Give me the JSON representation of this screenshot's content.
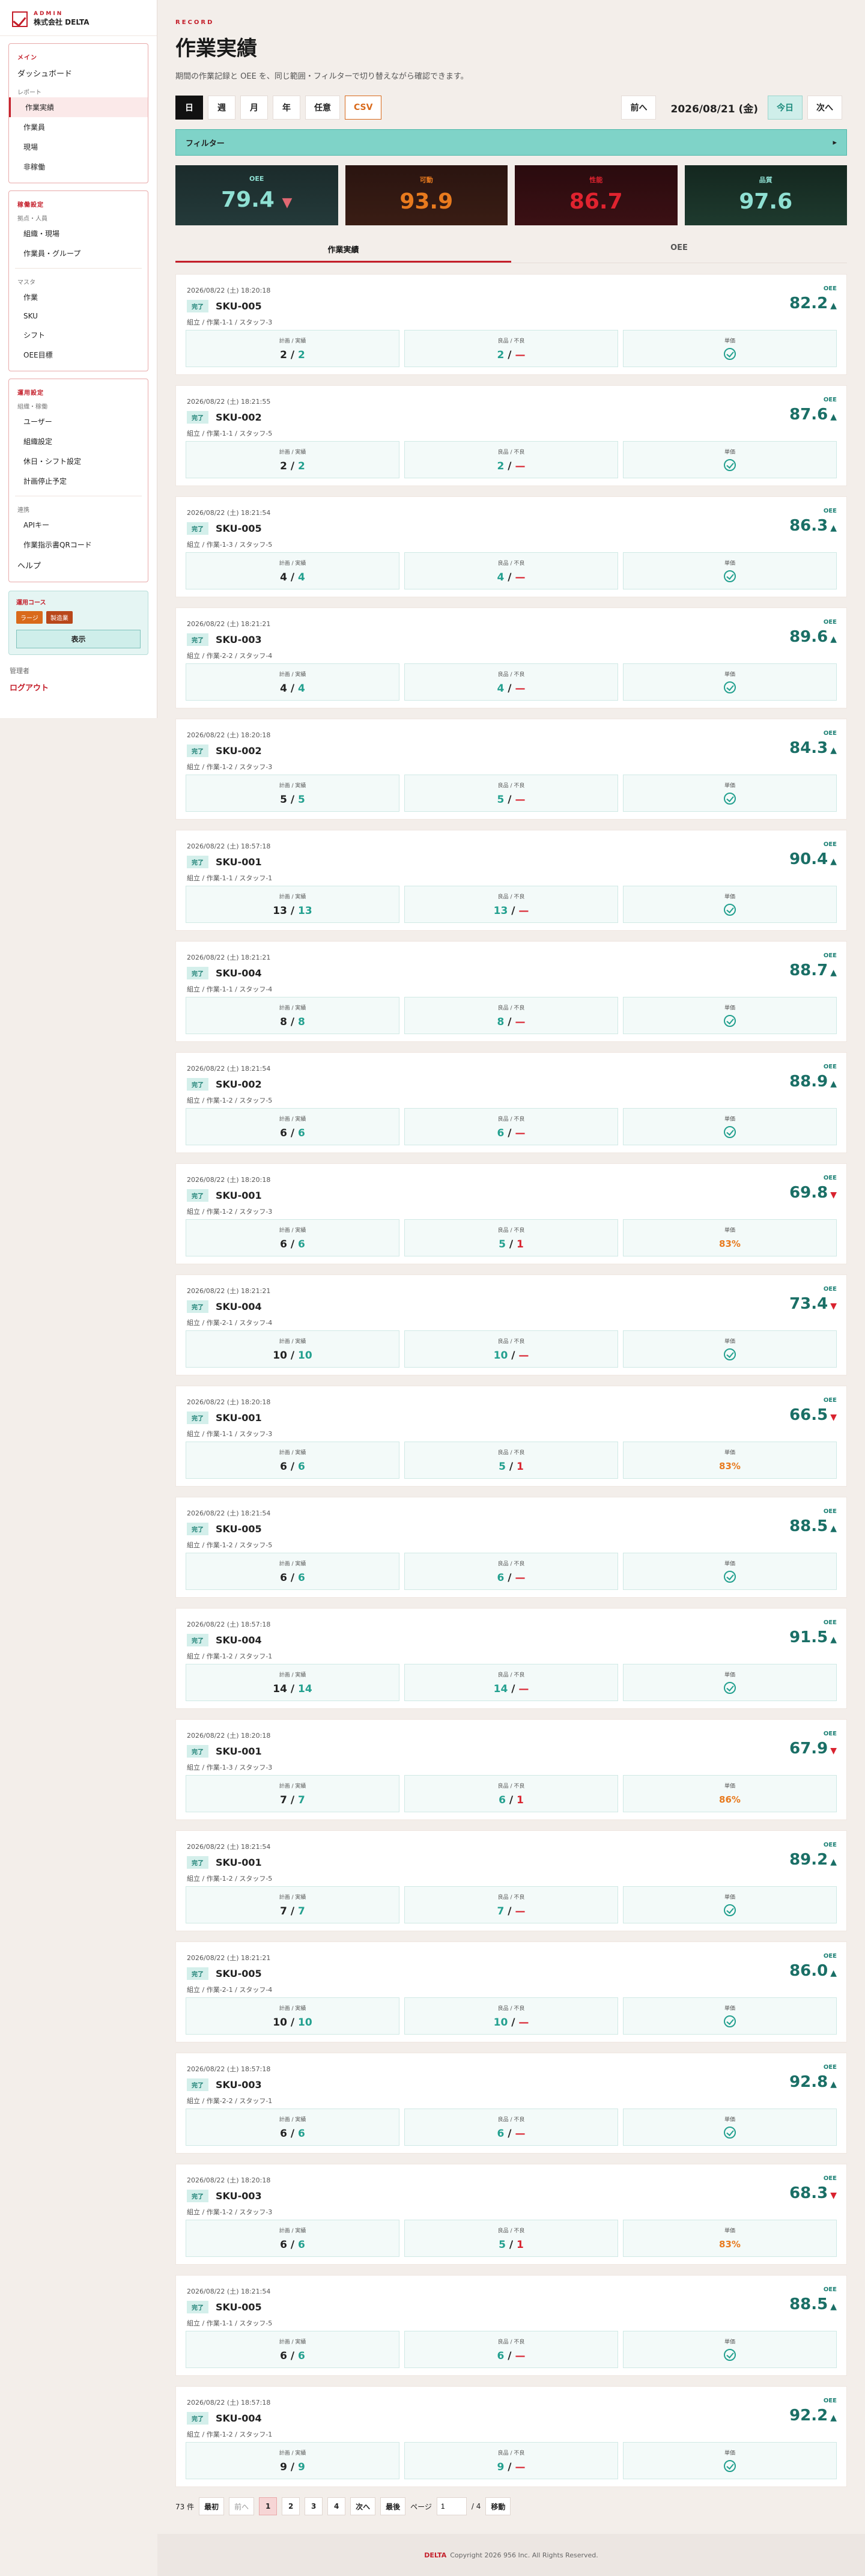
{
  "brand": {
    "small": "ADMIN",
    "name": "株式会社 DELTA"
  },
  "nav": {
    "main_head": "メイン",
    "dashboard": "ダッシュボード",
    "report_sub": "レポート",
    "report_items": [
      "作業実績",
      "作業員",
      "現場",
      "非稼働"
    ],
    "base_head": "稼働設定",
    "base_sub": "拠点・人員",
    "base_items": [
      "組織・現場",
      "作業員・グループ"
    ],
    "master_sub": "マスタ",
    "master_items": [
      "作業",
      "SKU",
      "シフト",
      "OEE目標"
    ],
    "ops_head": "運用設定",
    "ops_sub": "組織・稼働",
    "ops_items": [
      "ユーザー",
      "組織設定",
      "休日・シフト設定",
      "計画停止予定"
    ],
    "link_sub": "連携",
    "link_items": [
      "APIキー",
      "作業指示書QRコード"
    ],
    "help": "ヘルプ"
  },
  "legend": {
    "title": "運用コース",
    "chips": [
      "ラージ",
      "製造業"
    ],
    "button": "表示"
  },
  "user": {
    "role": "管理者",
    "logout": "ログアウト"
  },
  "page": {
    "tag": "RECORD",
    "title": "作業実績",
    "desc": "期間の作業記録と OEE を、同じ範囲・フィルターで切り替えながら確認できます。"
  },
  "toolbar": {
    "periods": [
      "日",
      "週",
      "月",
      "年",
      "任意"
    ],
    "csv": "CSV",
    "prev": "前へ",
    "date": "2026/08/21 (金)",
    "today": "今日",
    "next": "次へ"
  },
  "filter": {
    "label": "フィルター",
    "icon": "▸"
  },
  "kpis": [
    {
      "label": "OEE",
      "value": "79.4"
    },
    {
      "label": "可動",
      "value": "93.9"
    },
    {
      "label": "性能",
      "value": "86.7"
    },
    {
      "label": "品質",
      "value": "97.6"
    }
  ],
  "tabs": [
    "作業実績",
    "OEE"
  ],
  "labels": {
    "oee": "OEE",
    "plan": "計画 / 実績",
    "good": "良品 / 不良",
    "perf": "単価",
    "status": "完了",
    "dash": "—"
  },
  "records": [
    {
      "time": "2026/08/22 (土) 18:20:18",
      "sku": "SKU-005",
      "path": "組立 / 作業-1-1 / スタッフ-3",
      "oee": "82.2",
      "up": true,
      "plan": "2",
      "actual": "2",
      "good": "2",
      "bad": "—",
      "perf": ""
    },
    {
      "time": "2026/08/22 (土) 18:21:55",
      "sku": "SKU-002",
      "path": "組立 / 作業-1-1 / スタッフ-5",
      "oee": "87.6",
      "up": true,
      "plan": "2",
      "actual": "2",
      "good": "2",
      "bad": "—",
      "perf": ""
    },
    {
      "time": "2026/08/22 (土) 18:21:54",
      "sku": "SKU-005",
      "path": "組立 / 作業-1-3 / スタッフ-5",
      "oee": "86.3",
      "up": true,
      "plan": "4",
      "actual": "4",
      "good": "4",
      "bad": "—",
      "perf": ""
    },
    {
      "time": "2026/08/22 (土) 18:21:21",
      "sku": "SKU-003",
      "path": "組立 / 作業-2-2 / スタッフ-4",
      "oee": "89.6",
      "up": true,
      "plan": "4",
      "actual": "4",
      "good": "4",
      "bad": "—",
      "perf": ""
    },
    {
      "time": "2026/08/22 (土) 18:20:18",
      "sku": "SKU-002",
      "path": "組立 / 作業-1-2 / スタッフ-3",
      "oee": "84.3",
      "up": true,
      "plan": "5",
      "actual": "5",
      "good": "5",
      "bad": "—",
      "perf": ""
    },
    {
      "time": "2026/08/22 (土) 18:57:18",
      "sku": "SKU-001",
      "path": "組立 / 作業-1-1 / スタッフ-1",
      "oee": "90.4",
      "up": true,
      "plan": "13",
      "actual": "13",
      "good": "13",
      "bad": "—",
      "perf": ""
    },
    {
      "time": "2026/08/22 (土) 18:21:21",
      "sku": "SKU-004",
      "path": "組立 / 作業-1-1 / スタッフ-4",
      "oee": "88.7",
      "up": true,
      "plan": "8",
      "actual": "8",
      "good": "8",
      "bad": "—",
      "perf": ""
    },
    {
      "time": "2026/08/22 (土) 18:21:54",
      "sku": "SKU-002",
      "path": "組立 / 作業-1-2 / スタッフ-5",
      "oee": "88.9",
      "up": true,
      "plan": "6",
      "actual": "6",
      "good": "6",
      "bad": "—",
      "perf": ""
    },
    {
      "time": "2026/08/22 (土) 18:20:18",
      "sku": "SKU-001",
      "path": "組立 / 作業-1-2 / スタッフ-3",
      "oee": "69.8",
      "up": false,
      "plan": "6",
      "actual": "6",
      "good": "5",
      "bad": "1",
      "perf": "83"
    },
    {
      "time": "2026/08/22 (土) 18:21:21",
      "sku": "SKU-004",
      "path": "組立 / 作業-2-1 / スタッフ-4",
      "oee": "73.4",
      "up": false,
      "plan": "10",
      "actual": "10",
      "good": "10",
      "bad": "—",
      "perf": ""
    },
    {
      "time": "2026/08/22 (土) 18:20:18",
      "sku": "SKU-001",
      "path": "組立 / 作業-1-1 / スタッフ-3",
      "oee": "66.5",
      "up": false,
      "plan": "6",
      "actual": "6",
      "good": "5",
      "bad": "1",
      "perf": "83"
    },
    {
      "time": "2026/08/22 (土) 18:21:54",
      "sku": "SKU-005",
      "path": "組立 / 作業-1-2 / スタッフ-5",
      "oee": "88.5",
      "up": true,
      "plan": "6",
      "actual": "6",
      "good": "6",
      "bad": "—",
      "perf": ""
    },
    {
      "time": "2026/08/22 (土) 18:57:18",
      "sku": "SKU-004",
      "path": "組立 / 作業-1-2 / スタッフ-1",
      "oee": "91.5",
      "up": true,
      "plan": "14",
      "actual": "14",
      "good": "14",
      "bad": "—",
      "perf": ""
    },
    {
      "time": "2026/08/22 (土) 18:20:18",
      "sku": "SKU-001",
      "path": "組立 / 作業-1-3 / スタッフ-3",
      "oee": "67.9",
      "up": false,
      "plan": "7",
      "actual": "7",
      "good": "6",
      "bad": "1",
      "perf": "86"
    },
    {
      "time": "2026/08/22 (土) 18:21:54",
      "sku": "SKU-001",
      "path": "組立 / 作業-1-2 / スタッフ-5",
      "oee": "89.2",
      "up": true,
      "plan": "7",
      "actual": "7",
      "good": "7",
      "bad": "—",
      "perf": ""
    },
    {
      "time": "2026/08/22 (土) 18:21:21",
      "sku": "SKU-005",
      "path": "組立 / 作業-2-1 / スタッフ-4",
      "oee": "86.0",
      "up": true,
      "plan": "10",
      "actual": "10",
      "good": "10",
      "bad": "—",
      "perf": ""
    },
    {
      "time": "2026/08/22 (土) 18:57:18",
      "sku": "SKU-003",
      "path": "組立 / 作業-2-2 / スタッフ-1",
      "oee": "92.8",
      "up": true,
      "plan": "6",
      "actual": "6",
      "good": "6",
      "bad": "—",
      "perf": ""
    },
    {
      "time": "2026/08/22 (土) 18:20:18",
      "sku": "SKU-003",
      "path": "組立 / 作業-1-2 / スタッフ-3",
      "oee": "68.3",
      "up": false,
      "plan": "6",
      "actual": "6",
      "good": "5",
      "bad": "1",
      "perf": "83"
    },
    {
      "time": "2026/08/22 (土) 18:21:54",
      "sku": "SKU-005",
      "path": "組立 / 作業-1-1 / スタッフ-5",
      "oee": "88.5",
      "up": true,
      "plan": "6",
      "actual": "6",
      "good": "6",
      "bad": "—",
      "perf": ""
    },
    {
      "time": "2026/08/22 (土) 18:57:18",
      "sku": "SKU-004",
      "path": "組立 / 作業-1-2 / スタッフ-1",
      "oee": "92.2",
      "up": true,
      "plan": "9",
      "actual": "9",
      "good": "9",
      "bad": "—",
      "perf": ""
    }
  ],
  "pager": {
    "count": "73 件",
    "first": "最初",
    "prev": "前へ",
    "pages": [
      "1",
      "2",
      "3",
      "4"
    ],
    "next": "次へ",
    "last": "最後",
    "page_label": "ページ",
    "page_value": "1",
    "total": "/ 4",
    "go": "移動"
  },
  "footer": {
    "brand": "DELTA",
    "copy": "Copyright 2026 956 Inc. All Rights Reserved."
  }
}
